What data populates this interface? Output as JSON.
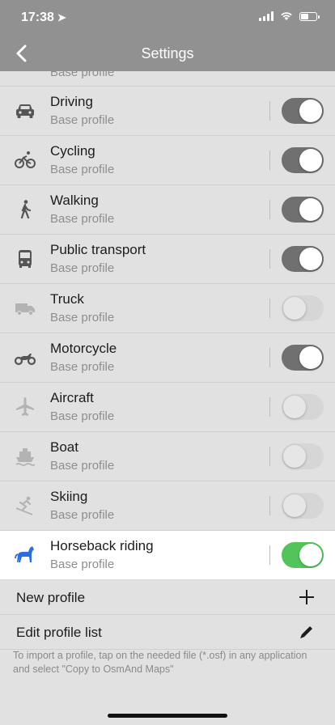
{
  "status": {
    "time": "17:38"
  },
  "nav": {
    "title": "Settings"
  },
  "partial_row": {
    "subtitle": "Base profile"
  },
  "profiles": [
    {
      "icon": "car-icon",
      "name": "Driving",
      "subtitle": "Base profile",
      "enabled": true
    },
    {
      "icon": "bicycle-icon",
      "name": "Cycling",
      "subtitle": "Base profile",
      "enabled": true
    },
    {
      "icon": "pedestrian-icon",
      "name": "Walking",
      "subtitle": "Base profile",
      "enabled": true
    },
    {
      "icon": "bus-icon",
      "name": "Public transport",
      "subtitle": "Base profile",
      "enabled": true
    },
    {
      "icon": "truck-icon",
      "name": "Truck",
      "subtitle": "Base profile",
      "enabled": false
    },
    {
      "icon": "motorcycle-icon",
      "name": "Motorcycle",
      "subtitle": "Base profile",
      "enabled": true
    },
    {
      "icon": "airplane-icon",
      "name": "Aircraft",
      "subtitle": "Base profile",
      "enabled": false
    },
    {
      "icon": "boat-icon",
      "name": "Boat",
      "subtitle": "Base profile",
      "enabled": false
    },
    {
      "icon": "skiing-icon",
      "name": "Skiing",
      "subtitle": "Base profile",
      "enabled": false
    },
    {
      "icon": "horse-icon",
      "name": "Horseback riding",
      "subtitle": "Base profile",
      "enabled": true
    }
  ],
  "actions": {
    "new_profile": "New profile",
    "edit_profile_list": "Edit profile list"
  },
  "footer": "To import a profile, tap on the needed file (*.osf) in any application and select \"Copy to OsmAnd Maps\"",
  "colors": {
    "bar": "#919191",
    "toggle_on": "#707070",
    "toggle_active": "#52c45a",
    "icon_active": "#2a6fe0",
    "background": "#e1e1e1"
  }
}
